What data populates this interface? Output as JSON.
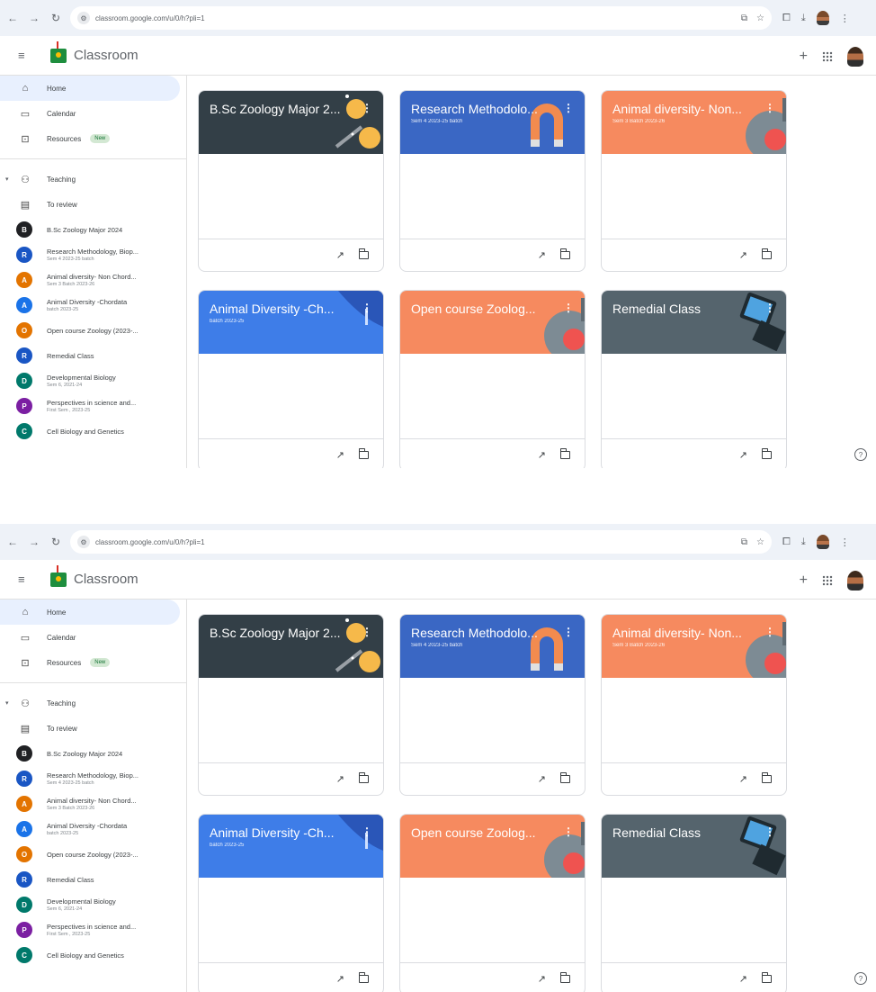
{
  "browser": {
    "url": "classroom.google.com/u/0/h?pli=1",
    "icons": [
      "back-icon",
      "forward-icon",
      "reload-icon",
      "site-settings-icon",
      "cast-icon",
      "star-icon",
      "extensions-icon",
      "download-icon",
      "profile-icon",
      "menu-icon"
    ]
  },
  "app": {
    "name": "Classroom",
    "add_icon": "+"
  },
  "sidebar": {
    "home": "Home",
    "calendar": "Calendar",
    "resources": "Resources",
    "resources_badge": "New",
    "teaching": "Teaching",
    "to_review": "To review",
    "courses": [
      {
        "letter": "B",
        "name": "B.Sc Zoology Major 2024",
        "sub": "",
        "color": "#202124"
      },
      {
        "letter": "R",
        "name": "Research Methodology, Biop...",
        "sub": "Sem 4 2023-25 batch",
        "color": "#1a56c4"
      },
      {
        "letter": "A",
        "name": "Animal diversity- Non Chord...",
        "sub": "Sem 3 Batch 2023-26",
        "color": "#e37400"
      },
      {
        "letter": "A",
        "name": "Animal Diversity -Chordata",
        "sub": "batch 2023-25",
        "color": "#1a73e8"
      },
      {
        "letter": "O",
        "name": "Open course Zoology (2023-...",
        "sub": "",
        "color": "#e37400"
      },
      {
        "letter": "R",
        "name": "Remedial Class",
        "sub": "",
        "color": "#1a56c4"
      },
      {
        "letter": "D",
        "name": "Developmental Biology",
        "sub": "Sem 6, 2021-24",
        "color": "#00796b"
      },
      {
        "letter": "P",
        "name": "Perspectives in science and...",
        "sub": "First Sem , 2023-25",
        "color": "#7b1fa2"
      },
      {
        "letter": "C",
        "name": "Cell Biology and Genetics",
        "sub": "",
        "color": "#00796b"
      }
    ]
  },
  "cards": [
    {
      "title": "B.Sc Zoology Major 2...",
      "subtitle": "",
      "color": "#333f47",
      "deco": "lamp"
    },
    {
      "title": "Research Methodolo...",
      "subtitle": "Sem 4 2023-25 batch",
      "color": "#3a67c4",
      "deco": "magnet"
    },
    {
      "title": "Animal diversity- Non...",
      "subtitle": "Sem 3 Batch 2023-26",
      "color": "#f68a5f",
      "deco": "globe"
    },
    {
      "title": "Animal Diversity -Ch...",
      "subtitle": "batch 2023-25",
      "color": "#3e7de8",
      "deco": "book"
    },
    {
      "title": "Open course Zoolog...",
      "subtitle": "",
      "color": "#f68a5f",
      "deco": "globe"
    },
    {
      "title": "Remedial Class",
      "subtitle": "",
      "color": "#55646d",
      "deco": "tablet"
    }
  ],
  "colors": {
    "chrome_bg": "#eef2f8",
    "active_nav": "#e8f0fe",
    "border": "#dadce0"
  }
}
